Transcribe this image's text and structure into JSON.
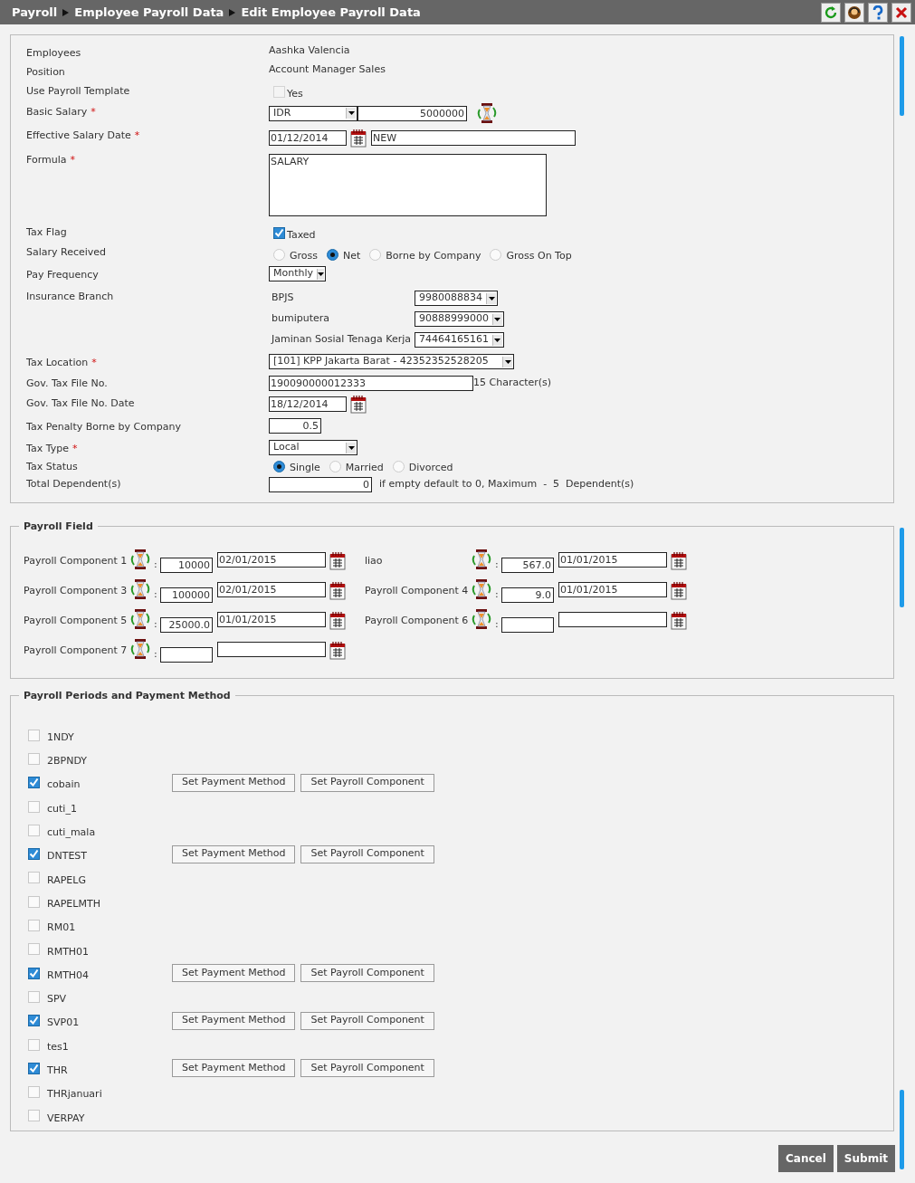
{
  "breadcrumb": [
    "Payroll",
    "Employee Payroll Data",
    "Edit Employee Payroll Data"
  ],
  "form": {
    "rows": [
      {
        "kind": "text",
        "label": "Employees",
        "value": "Aashka Valencia"
      },
      {
        "kind": "text",
        "label": "Position",
        "value": "Account Manager Sales"
      },
      {
        "kind": "checkbox",
        "label": "Use Payroll Template",
        "option": "Yes",
        "checked": false,
        "disabled": true
      },
      {
        "kind": "currency",
        "label": "Basic Salary",
        "required_mark": "*",
        "currency": "IDR",
        "value": "5000000"
      },
      {
        "kind": "date_text",
        "label": "Effective Salary Date",
        "required_mark": "*",
        "date": "01/12/2014",
        "value": "NEW"
      },
      {
        "kind": "textarea",
        "label": "Formula",
        "required_mark": "*",
        "value": "SALARY"
      },
      {
        "kind": "checkbox",
        "label": "Tax Flag",
        "option": "Taxed",
        "checked": true
      },
      {
        "kind": "radio",
        "label": "Salary Received",
        "options": [
          {
            "label": "Gross",
            "selected": false
          },
          {
            "label": "Net",
            "selected": true
          },
          {
            "label": "Borne by Company",
            "selected": false
          },
          {
            "label": "Gross On Top",
            "selected": false
          }
        ]
      },
      {
        "kind": "select",
        "label": "Pay Frequency",
        "value": "Monthly"
      },
      {
        "kind": "insurance",
        "label": "Insurance Branch",
        "items": [
          {
            "name": "BPJS",
            "value": "9980088834"
          },
          {
            "name": "bumiputera",
            "value": "90888999000"
          },
          {
            "name": "Jaminan Sosial Tenaga Kerja",
            "value": "74464165161"
          }
        ]
      },
      {
        "kind": "select_wide",
        "label": "Tax Location",
        "required_mark": "*",
        "value": "[101] KPP Jakarta Barat - 42352352528205"
      },
      {
        "kind": "input_note",
        "label": "Gov. Tax File No.",
        "value": "190090000012333",
        "note": "15 Character(s)"
      },
      {
        "kind": "date",
        "label": "Gov. Tax File No. Date",
        "date": "18/12/2014"
      },
      {
        "kind": "number",
        "label": "Tax Penalty Borne by Company",
        "value": "0.5"
      },
      {
        "kind": "select",
        "label": "Tax Type",
        "required_mark": "*",
        "value": "Local"
      },
      {
        "kind": "radio",
        "label": "Tax Status",
        "options": [
          {
            "label": "Single",
            "selected": true
          },
          {
            "label": "Married",
            "selected": false
          },
          {
            "label": "Divorced",
            "selected": false
          }
        ]
      },
      {
        "kind": "input_note",
        "label": "Total Dependent(s)",
        "value": "0",
        "note": "if empty default to 0, Maximum  -  5  Dependent(s)"
      }
    ]
  },
  "payroll_field": {
    "legend": "Payroll Field",
    "components": [
      {
        "label": "Payroll Component 1",
        "separator": ":",
        "amount": "10000",
        "date": "02/01/2015"
      },
      {
        "label": "liao",
        "separator": ":",
        "amount": "567.0",
        "date": "01/01/2015"
      },
      {
        "label": "Payroll Component 3",
        "separator": ":",
        "amount": "100000",
        "date": "02/01/2015"
      },
      {
        "label": "Payroll Component 4",
        "separator": ":",
        "amount": "9.0",
        "date": "01/01/2015"
      },
      {
        "label": "Payroll Component 5",
        "separator": ":",
        "amount": "25000.0",
        "date": "01/01/2015"
      },
      {
        "label": "Payroll Component 6",
        "separator": ":"
      },
      {
        "label": "Payroll Component 7",
        "separator": ":"
      }
    ]
  },
  "periods": {
    "legend": "Payroll Periods and Payment Method",
    "items": [
      {
        "name": "1NDY",
        "checked": false
      },
      {
        "name": "2BPNDY",
        "checked": false
      },
      {
        "name": "cobain",
        "checked": true,
        "actions": [
          "Set Payment Method",
          "Set Payroll Component"
        ]
      },
      {
        "name": "cuti_1",
        "checked": false
      },
      {
        "name": "cuti_mala",
        "checked": false
      },
      {
        "name": "DNTEST",
        "checked": true,
        "actions": [
          "Set Payment Method",
          "Set Payroll Component"
        ]
      },
      {
        "name": "RAPELG",
        "checked": false
      },
      {
        "name": "RAPELMTH",
        "checked": false
      },
      {
        "name": "RM01",
        "checked": false
      },
      {
        "name": "RMTH01",
        "checked": false
      },
      {
        "name": "RMTH04",
        "checked": true,
        "actions": [
          "Set Payment Method",
          "Set Payroll Component"
        ]
      },
      {
        "name": "SPV",
        "checked": false
      },
      {
        "name": "SVP01",
        "checked": true,
        "actions": [
          "Set Payment Method",
          "Set Payroll Component"
        ]
      },
      {
        "name": "tes1",
        "checked": false
      },
      {
        "name": "THR",
        "checked": true,
        "actions": [
          "Set Payment Method",
          "Set Payroll Component"
        ]
      },
      {
        "name": "THRjanuari",
        "checked": false
      },
      {
        "name": "VERPAY",
        "checked": false
      }
    ]
  },
  "buttons": [
    "Cancel",
    "Submit"
  ]
}
